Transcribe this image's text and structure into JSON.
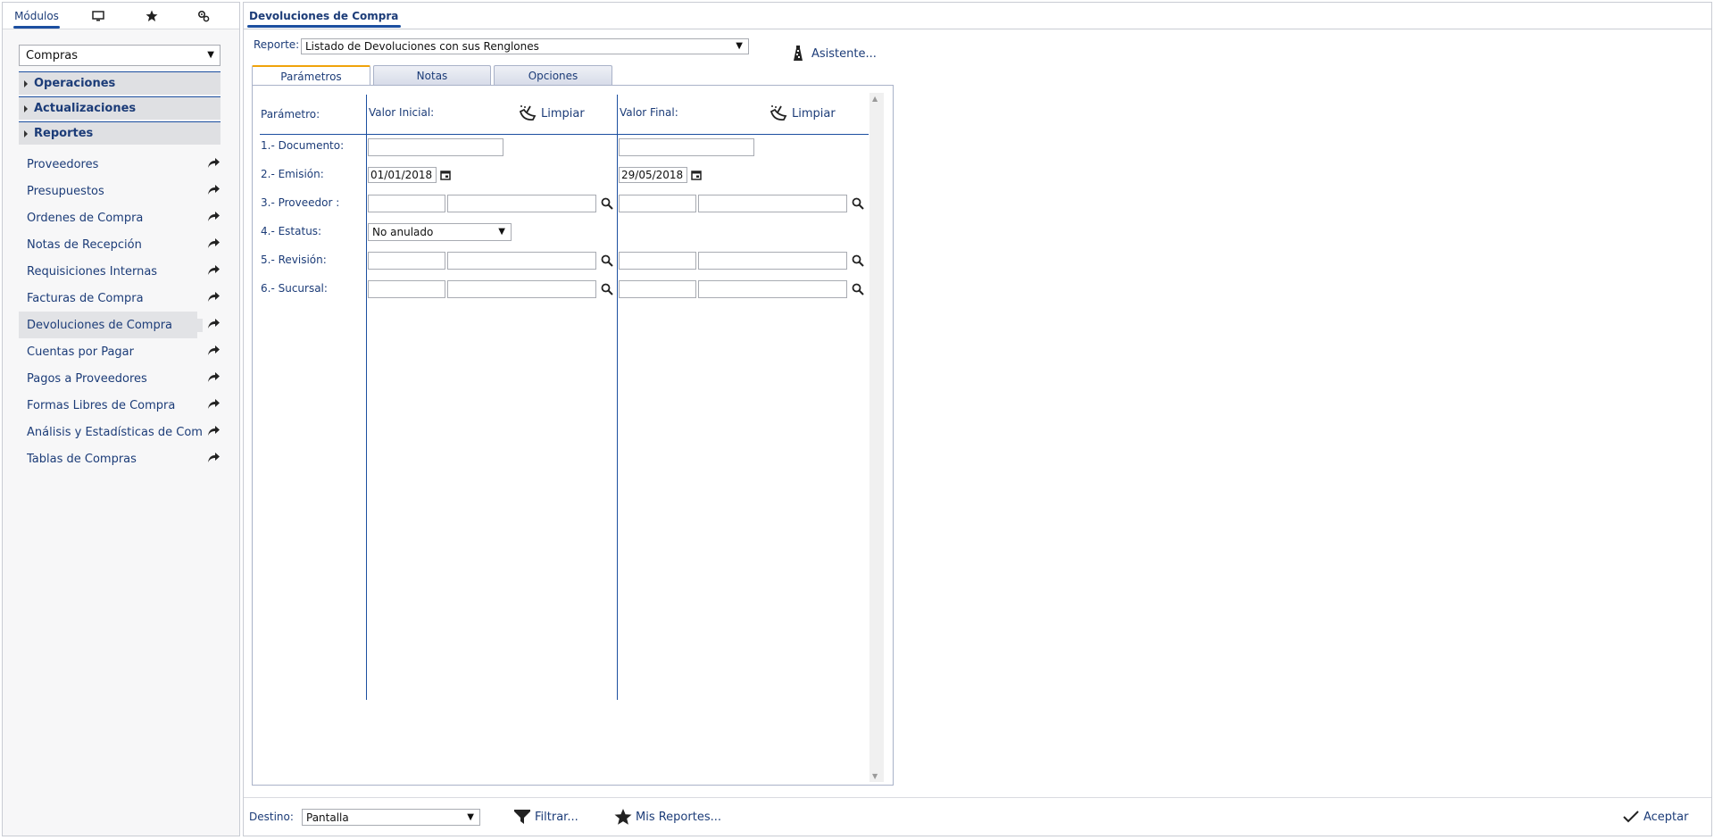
{
  "left": {
    "tabs": [
      {
        "label": "Módulos",
        "icon": "modules"
      },
      {
        "icon": "monitor-icon"
      },
      {
        "icon": "star-icon"
      },
      {
        "icon": "gears-icon"
      }
    ],
    "module_select": "Compras",
    "sections": [
      "Operaciones",
      "Actualizaciones",
      "Reportes"
    ],
    "items": [
      "Proveedores",
      "Presupuestos",
      "Órdenes de Compra",
      "Notas de Recepción",
      "Requisiciones Internas",
      "Facturas de Compra",
      "Devoluciones de Compra",
      "Cuentas por Pagar",
      "Pagos a Proveedores",
      "Formas Libres de Compra",
      "Análisis y Estadísticas de Com",
      "Tablas de Compras"
    ],
    "selected_item": "Devoluciones de Compra"
  },
  "main": {
    "tab_title": "Devoluciones de Compra",
    "report_label": "Reporte:",
    "report_value": "Listado de Devoluciones con sus Renglones",
    "asistente": "Asistente...",
    "param_tabs": [
      "Parámetros",
      "Notas",
      "Opciones"
    ],
    "header": {
      "parametro": "Parámetro:",
      "valor_inicial": "Valor Inicial:",
      "valor_final": "Valor Final:",
      "limpiar": "Limpiar"
    },
    "params": [
      {
        "label": "1.- Documento:"
      },
      {
        "label": "2.- Emisión:",
        "from": "01/01/2018",
        "to": "29/05/2018"
      },
      {
        "label": "3.- Proveedor :"
      },
      {
        "label": "4.- Estatus:",
        "value": "No anulado"
      },
      {
        "label": "5.- Revisión:"
      },
      {
        "label": "6.- Sucursal:"
      }
    ]
  },
  "footer": {
    "destino_label": "Destino:",
    "destino_value": "Pantalla",
    "filtrar": "Filtrar...",
    "mis_reportes": "Mis Reportes...",
    "aceptar": "Aceptar"
  },
  "colors": {
    "accent": "#1c4fa0",
    "text": "#1c3c78",
    "tab_highlight": "#f0a30a"
  }
}
